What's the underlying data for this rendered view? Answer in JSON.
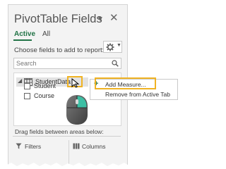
{
  "pane": {
    "title": "PivotTable Fields",
    "dropdown_icon": "triangle-down-icon",
    "close_icon": "close-icon",
    "tabs": [
      {
        "label": "Active",
        "active": true
      },
      {
        "label": "All",
        "active": false
      }
    ],
    "choose_text": "Choose fields to add to report:",
    "tools_icon": "gear-icon",
    "search": {
      "placeholder": "Search",
      "icon": "search-icon"
    },
    "table": {
      "label": "StudentData",
      "icon": "table-icon"
    },
    "fields": [
      {
        "label": "Student",
        "checked": false
      },
      {
        "label": "Course",
        "checked": false
      }
    ],
    "drag_text": "Drag fields between areas below:",
    "areas": [
      {
        "label": "Filters",
        "icon": "filter-icon"
      },
      {
        "label": "Columns",
        "icon": "columns-icon"
      }
    ]
  },
  "context_menu": {
    "items": [
      {
        "label": "Add Measure...",
        "icon": "plus-icon"
      },
      {
        "label": "Remove from Active Tab"
      }
    ]
  },
  "colors": {
    "accent": "#217346",
    "highlight": "#f0b323",
    "mouse_button": "#3dbfa4"
  }
}
